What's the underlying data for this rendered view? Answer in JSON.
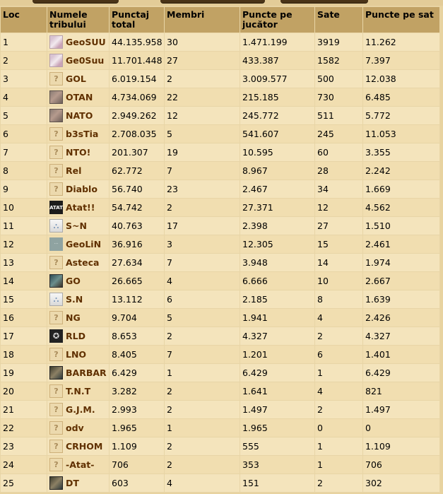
{
  "headers": {
    "rank": "Loc",
    "tribe": "Numele tribului",
    "points": "Punctaj total",
    "members": "Membri",
    "per_player": "Puncte pe jucător",
    "villages": "Sate",
    "per_village": "Puncte pe sat"
  },
  "colors": {
    "header_bg": "#c1a264",
    "row_bg": "#f4e4bc",
    "link": "#603000"
  },
  "rows": [
    {
      "rank": "1",
      "tag": "GeoSUU",
      "avatar": "pink-image",
      "points": "44.135.958",
      "members": "30",
      "per_player": "1.471.199",
      "villages": "3919",
      "per_village": "11.262"
    },
    {
      "rank": "2",
      "tag": "Ge0Suu",
      "avatar": "pink-image",
      "points": "11.701.448",
      "members": "27",
      "per_player": "433.387",
      "villages": "1582",
      "per_village": "7.397"
    },
    {
      "rank": "3",
      "tag": "GOL",
      "avatar": "question-mark",
      "points": "6.019.154",
      "members": "2",
      "per_player": "3.009.577",
      "villages": "500",
      "per_village": "12.038"
    },
    {
      "rank": "4",
      "tag": "OTAN",
      "avatar": "stone-image",
      "points": "4.734.069",
      "members": "22",
      "per_player": "215.185",
      "villages": "730",
      "per_village": "6.485"
    },
    {
      "rank": "5",
      "tag": "NATO",
      "avatar": "stone-image",
      "points": "2.949.262",
      "members": "12",
      "per_player": "245.772",
      "villages": "511",
      "per_village": "5.772"
    },
    {
      "rank": "6",
      "tag": "b3sTia",
      "avatar": "question-mark",
      "points": "2.708.035",
      "members": "5",
      "per_player": "541.607",
      "villages": "245",
      "per_village": "11.053"
    },
    {
      "rank": "7",
      "tag": "NTO!",
      "avatar": "question-mark",
      "points": "201.307",
      "members": "19",
      "per_player": "10.595",
      "villages": "60",
      "per_village": "3.355"
    },
    {
      "rank": "8",
      "tag": "Rel",
      "avatar": "question-mark",
      "points": "62.772",
      "members": "7",
      "per_player": "8.967",
      "villages": "28",
      "per_village": "2.242"
    },
    {
      "rank": "9",
      "tag": "Diablo",
      "avatar": "question-mark",
      "points": "56.740",
      "members": "23",
      "per_player": "2.467",
      "villages": "34",
      "per_village": "1.669"
    },
    {
      "rank": "10",
      "tag": "Atat!!",
      "avatar": "black-logo",
      "points": "54.742",
      "members": "2",
      "per_player": "27.371",
      "villages": "12",
      "per_village": "4.562"
    },
    {
      "rank": "11",
      "tag": "S~N",
      "avatar": "light-figure",
      "points": "40.763",
      "members": "17",
      "per_player": "2.398",
      "villages": "27",
      "per_village": "1.510"
    },
    {
      "rank": "12",
      "tag": "GeoLiN",
      "avatar": "grey-image",
      "points": "36.916",
      "members": "3",
      "per_player": "12.305",
      "villages": "15",
      "per_village": "2.461"
    },
    {
      "rank": "13",
      "tag": "Asteca",
      "avatar": "question-mark",
      "points": "27.634",
      "members": "7",
      "per_player": "3.948",
      "villages": "14",
      "per_village": "1.974"
    },
    {
      "rank": "14",
      "tag": "GO",
      "avatar": "teal-image",
      "points": "26.665",
      "members": "4",
      "per_player": "6.666",
      "villages": "10",
      "per_village": "2.667"
    },
    {
      "rank": "15",
      "tag": "S.N",
      "avatar": "light-figure",
      "points": "13.112",
      "members": "6",
      "per_player": "2.185",
      "villages": "8",
      "per_village": "1.639"
    },
    {
      "rank": "16",
      "tag": "NG",
      "avatar": "question-mark",
      "points": "9.704",
      "members": "5",
      "per_player": "1.941",
      "villages": "4",
      "per_village": "2.426"
    },
    {
      "rank": "17",
      "tag": "RLD",
      "avatar": "dark-emblem",
      "points": "8.653",
      "members": "2",
      "per_player": "4.327",
      "villages": "2",
      "per_village": "4.327"
    },
    {
      "rank": "18",
      "tag": "LNO",
      "avatar": "question-mark",
      "points": "8.405",
      "members": "7",
      "per_player": "1.201",
      "villages": "6",
      "per_village": "1.401"
    },
    {
      "rank": "19",
      "tag": "BARBAR",
      "avatar": "brown-image",
      "points": "6.429",
      "members": "1",
      "per_player": "6.429",
      "villages": "1",
      "per_village": "6.429"
    },
    {
      "rank": "20",
      "tag": "T.N.T",
      "avatar": "question-mark",
      "points": "3.282",
      "members": "2",
      "per_player": "1.641",
      "villages": "4",
      "per_village": "821"
    },
    {
      "rank": "21",
      "tag": "G.J.M.",
      "avatar": "question-mark",
      "points": "2.993",
      "members": "2",
      "per_player": "1.497",
      "villages": "2",
      "per_village": "1.497"
    },
    {
      "rank": "22",
      "tag": "odv",
      "avatar": "question-mark",
      "points": "1.965",
      "members": "1",
      "per_player": "1.965",
      "villages": "0",
      "per_village": "0"
    },
    {
      "rank": "23",
      "tag": "CRHOM",
      "avatar": "question-mark",
      "points": "1.109",
      "members": "2",
      "per_player": "555",
      "villages": "1",
      "per_village": "1.109"
    },
    {
      "rank": "24",
      "tag": "-Atat-",
      "avatar": "question-mark",
      "points": "706",
      "members": "2",
      "per_player": "353",
      "villages": "1",
      "per_village": "706"
    },
    {
      "rank": "25",
      "tag": "DT",
      "avatar": "brown-image",
      "points": "603",
      "members": "4",
      "per_player": "151",
      "villages": "2",
      "per_village": "302"
    }
  ]
}
